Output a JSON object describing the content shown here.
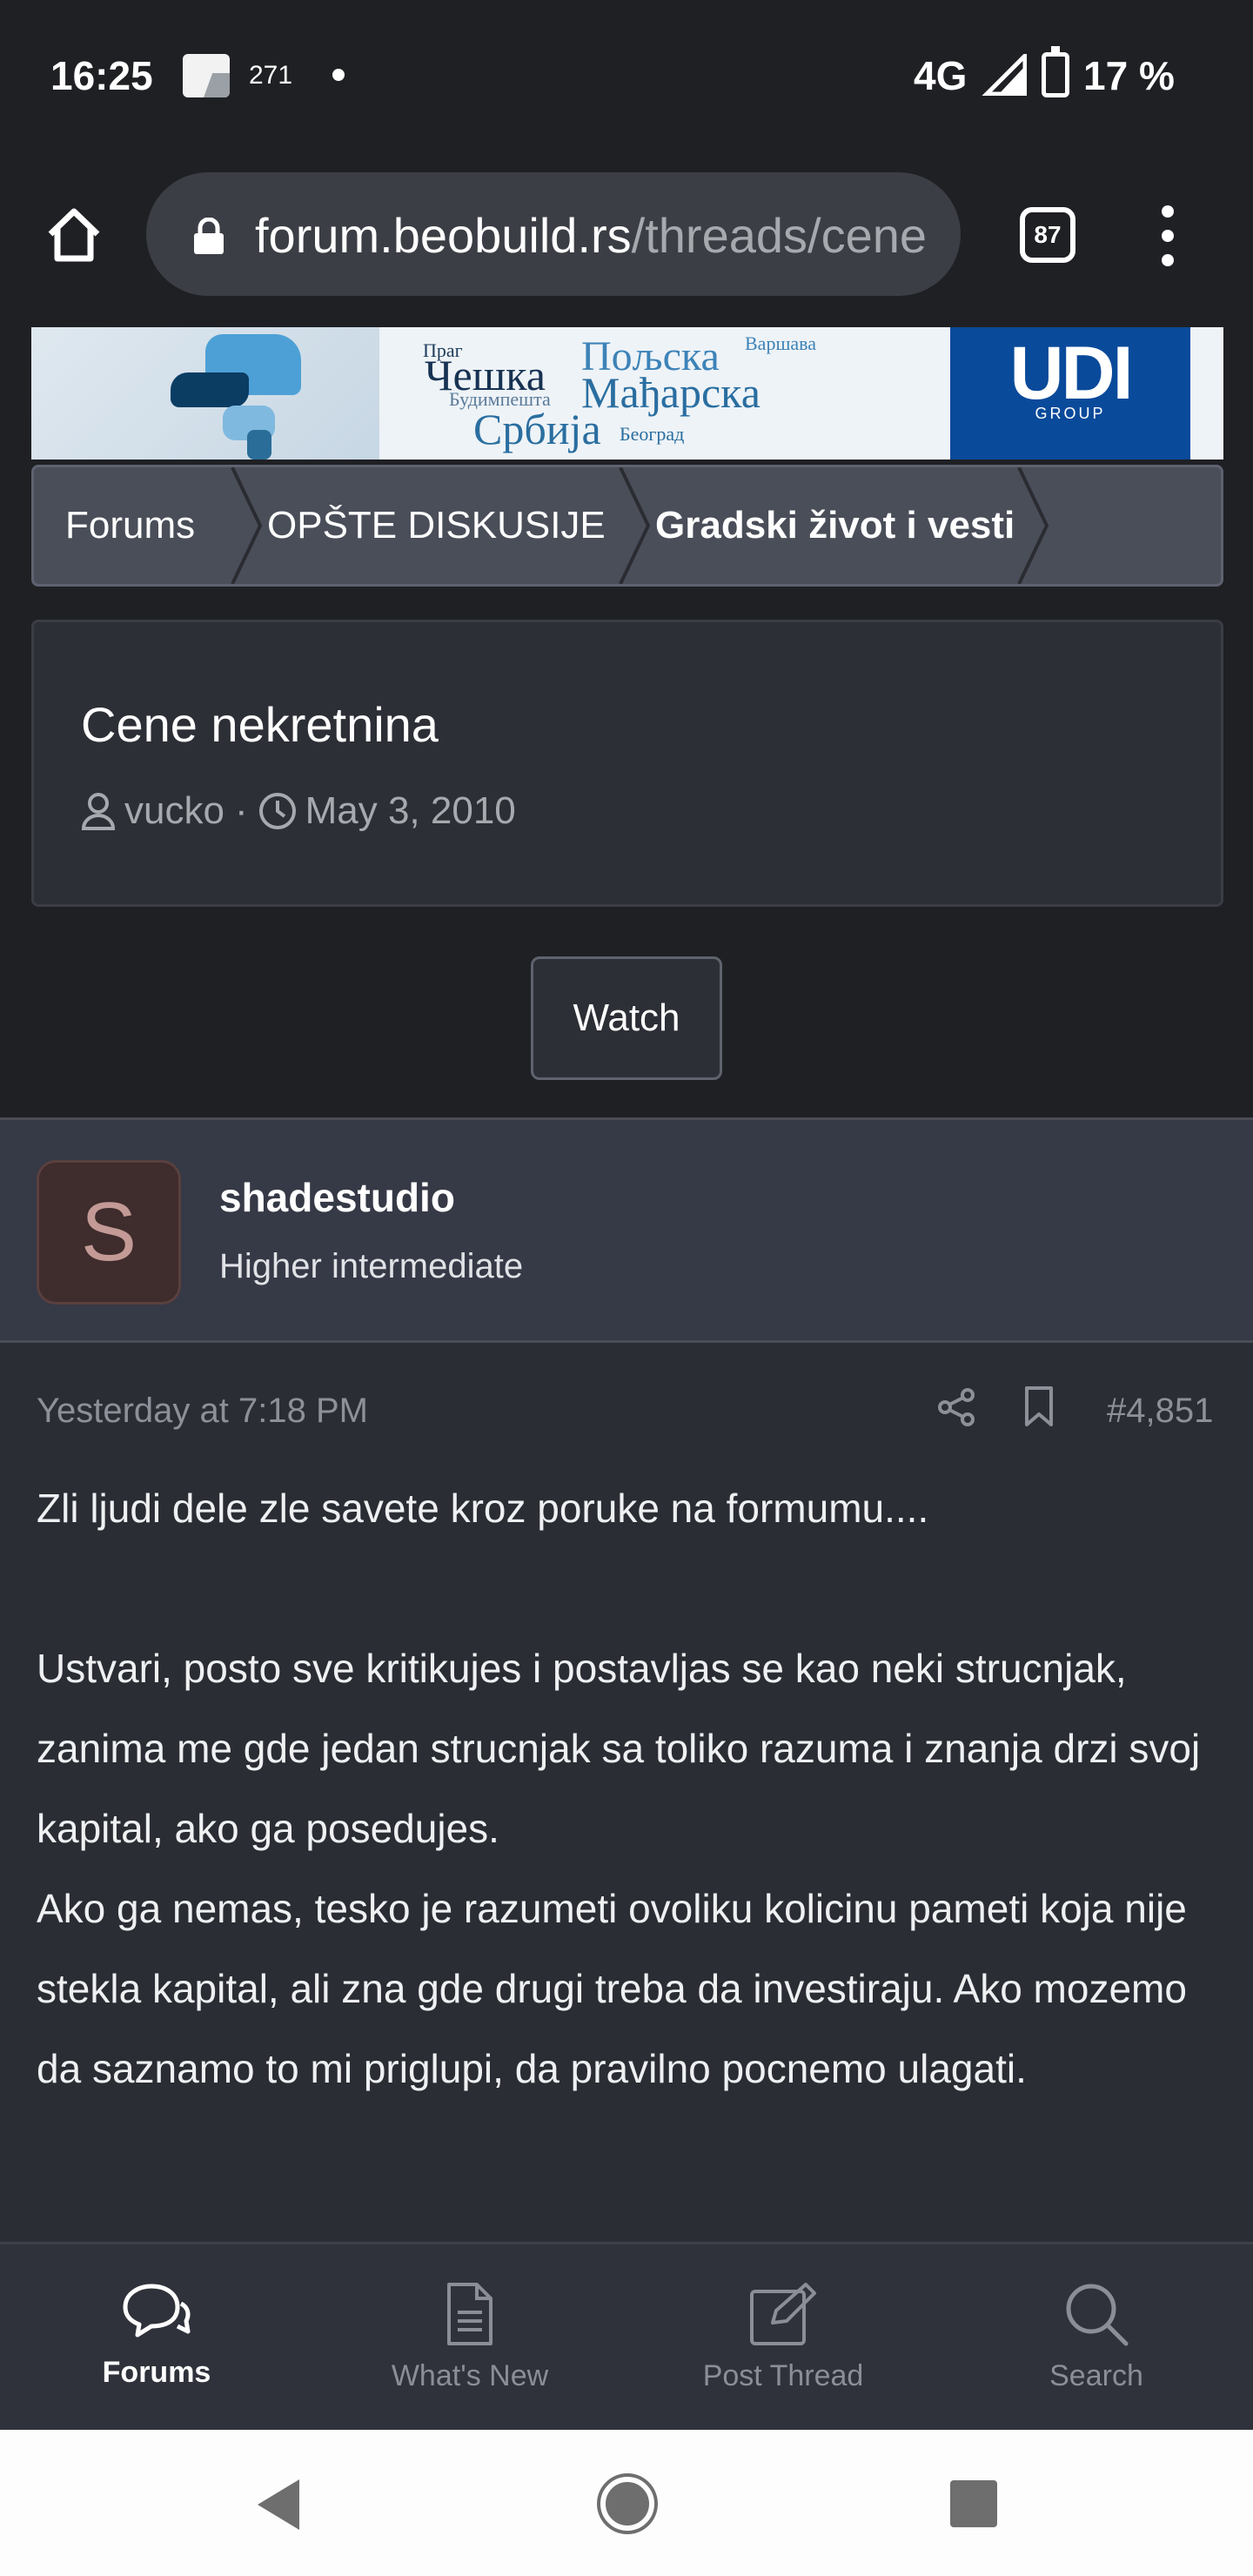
{
  "status_bar": {
    "time": "16:25",
    "notification_count": "271",
    "network": "4G",
    "battery": "17 %"
  },
  "browser": {
    "url_domain": "forum.beobuild.rs",
    "url_path": "/threads/cene",
    "tab_count": "87"
  },
  "banner": {
    "words": [
      "Праг",
      "Чешка",
      "Пољска",
      "Варшава",
      "Будимпешта",
      "Мађарска",
      "Србија",
      "Београд"
    ],
    "brand": "UDI",
    "brand_sub": "GROUP"
  },
  "breadcrumb": {
    "items": [
      "Forums",
      "OPŠTE DISKUSIJE",
      "Gradski život i vesti"
    ]
  },
  "thread": {
    "title": "Cene nekretnina",
    "author": "vucko",
    "separator": "·",
    "date": "May 3, 2010",
    "watch_label": "Watch"
  },
  "post": {
    "avatar_letter": "S",
    "username": "shadestudio",
    "user_title": "Higher intermediate",
    "date": "Yesterday at 7:18 PM",
    "number": "#4,851",
    "body": [
      "Zli ljudi dele zle savete kroz poruke na formumu....",
      "Ustvari, posto sve kritikujes i postavljas se kao neki strucnjak, zanima me gde jedan strucnjak sa toliko razuma i znanja drzi svoj kapital, ako ga posedujes.",
      "Ako ga nemas, tesko je razumeti ovoliku kolicinu pameti koja nije stekla kapital, ali zna gde drugi treba da investiraju. Ako mozemo da saznamo to mi priglupi, da pravilno pocnemo ulagati."
    ]
  },
  "bottom_nav": {
    "items": [
      {
        "label": "Forums",
        "icon": "chat-bubbles-icon"
      },
      {
        "label": "What's New",
        "icon": "document-icon"
      },
      {
        "label": "Post Thread",
        "icon": "edit-icon"
      },
      {
        "label": "Search",
        "icon": "search-icon"
      }
    ]
  },
  "colors": {
    "page_bg": "#1f2024",
    "card_bg": "#2d2f36",
    "user_bar_bg": "#363946",
    "muted_text": "#8d9098",
    "udi_blue": "#0a4a9a"
  }
}
